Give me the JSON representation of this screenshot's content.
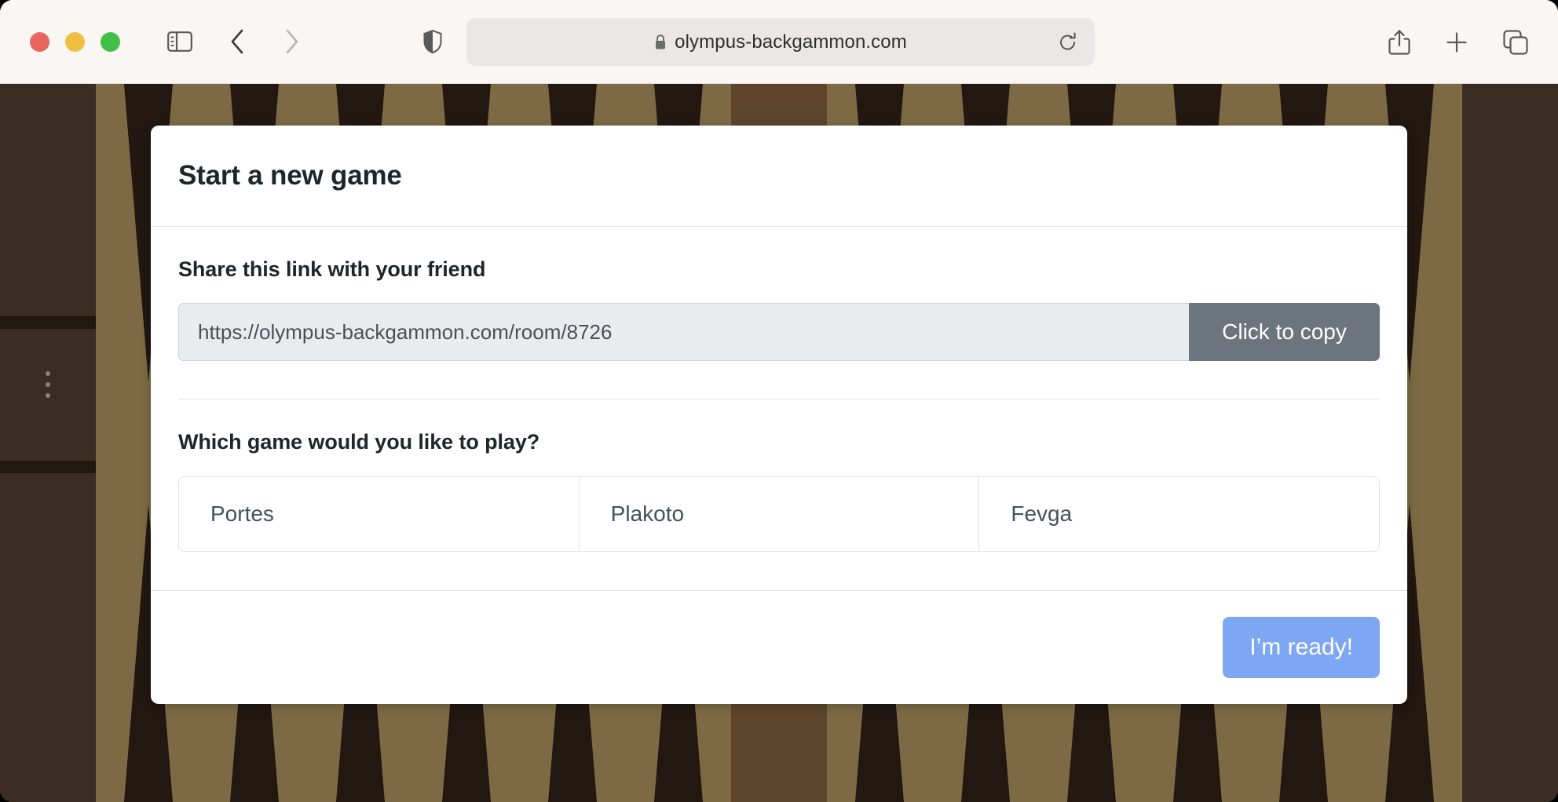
{
  "browser": {
    "url_text": "olympus-backgammon.com",
    "lock_icon": "lock-icon",
    "reload_icon": "reload-icon",
    "sidebar_icon": "sidebar-toggle-icon",
    "back_icon": "back-arrow-icon",
    "forward_icon": "forward-arrow-icon",
    "shield_icon": "privacy-shield-icon",
    "share_icon": "share-icon",
    "new_tab_icon": "plus-icon",
    "tabs_icon": "tab-overview-icon",
    "traffic_lights": [
      "close-red",
      "minimize-yellow",
      "zoom-green"
    ]
  },
  "dialog": {
    "title": "Start a new game",
    "share_label": "Share this link with your friend",
    "room_url": "https://olympus-backgammon.com/room/8726",
    "copy_label": "Click to copy",
    "game_question": "Which game would you like to play?",
    "game_options": [
      {
        "label": "Portes"
      },
      {
        "label": "Plakoto"
      },
      {
        "label": "Fevga"
      }
    ],
    "ready_label": "I’m ready!"
  },
  "board": {
    "menu_icon": "overflow-menu-icon",
    "colors": {
      "felt": "#7d6a44",
      "point_dark": "#221711",
      "tray": "#3b2d22",
      "center_bar": "#5c452c"
    }
  },
  "theme": {
    "accent_blue": "#7da7f2",
    "copy_gray": "#6c757d",
    "text_dark": "#212529",
    "text_muted": "#495057"
  }
}
